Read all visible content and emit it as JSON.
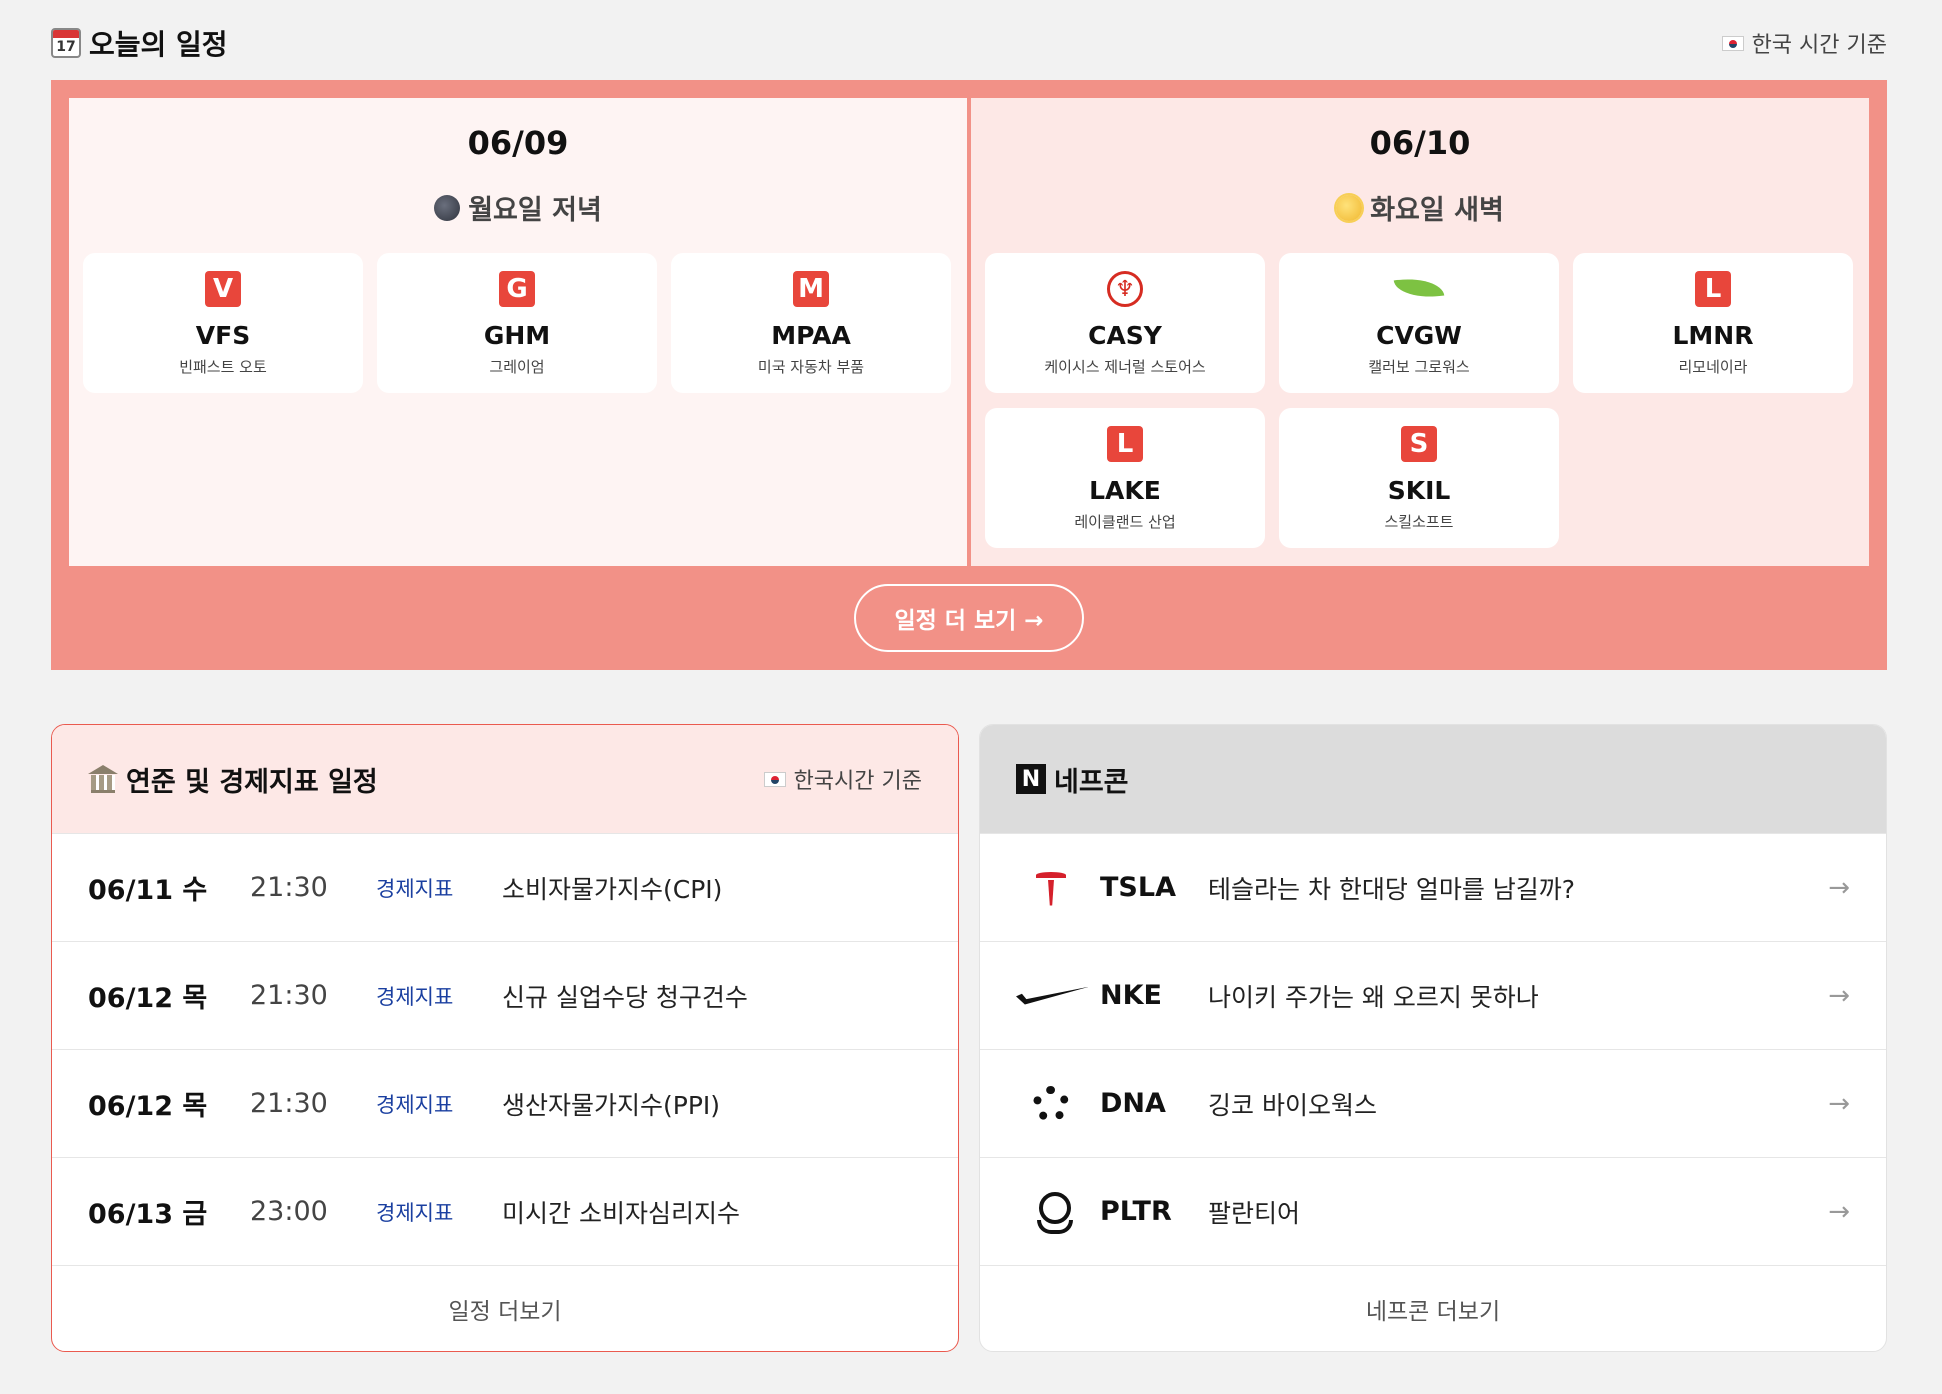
{
  "header": {
    "title": "오늘의 일정",
    "calendar_day": "17",
    "timezone_note": "한국 시간 기준"
  },
  "schedule": {
    "days": [
      {
        "date": "06/09",
        "session": "월요일 저녁",
        "companies": [
          {
            "ticker": "VFS",
            "name": "빈패스트 오토",
            "letter": "V"
          },
          {
            "ticker": "GHM",
            "name": "그레이엄",
            "letter": "G"
          },
          {
            "ticker": "MPAA",
            "name": "미국 자동차 부품",
            "letter": "M"
          }
        ]
      },
      {
        "date": "06/10",
        "session": "화요일 새벽",
        "companies": [
          {
            "ticker": "CASY",
            "name": "케이시스 제너럴 스토어스",
            "letter": "♆"
          },
          {
            "ticker": "CVGW",
            "name": "캘러보 그로워스",
            "letter": ""
          },
          {
            "ticker": "LMNR",
            "name": "리모네이라",
            "letter": "L"
          },
          {
            "ticker": "LAKE",
            "name": "레이클랜드 산업",
            "letter": "L"
          },
          {
            "ticker": "SKIL",
            "name": "스킬소프트",
            "letter": "S"
          }
        ]
      }
    ],
    "more_label": "일정 더 보기 →"
  },
  "fed": {
    "title": "연준 및 경제지표 일정",
    "timezone_note": "한국시간 기준",
    "events": [
      {
        "date": "06/11 수",
        "time": "21:30",
        "tag": "경제지표",
        "name": "소비자물가지수(CPI)"
      },
      {
        "date": "06/12 목",
        "time": "21:30",
        "tag": "경제지표",
        "name": "신규 실업수당 청구건수"
      },
      {
        "date": "06/12 목",
        "time": "21:30",
        "tag": "경제지표",
        "name": "생산자물가지수(PPI)"
      },
      {
        "date": "06/13 금",
        "time": "23:00",
        "tag": "경제지표",
        "name": "미시간 소비자심리지수"
      }
    ],
    "more_label": "일정 더보기"
  },
  "nepcon": {
    "title": "네프콘",
    "logo_letter": "N",
    "items": [
      {
        "ticker": "TSLA",
        "title": "테슬라는 차 한대당 얼마를 남길까?",
        "icon": "tesla-logo-icon"
      },
      {
        "ticker": "NKE",
        "title": "나이키 주가는 왜 오르지 못하나",
        "icon": "nike-swoosh-icon"
      },
      {
        "ticker": "DNA",
        "title": "깅코 바이오웍스",
        "icon": "ginkgo-logo-icon"
      },
      {
        "ticker": "PLTR",
        "title": "팔란티어",
        "icon": "palantir-logo-icon"
      }
    ],
    "arrow": "→",
    "more_label": "네프콘 더보기"
  },
  "colors": {
    "schedule_bg": "#f29187",
    "logo_red": "#e8463b",
    "tag_blue": "#1a3fa0",
    "fed_border": "#ea5a4f"
  }
}
